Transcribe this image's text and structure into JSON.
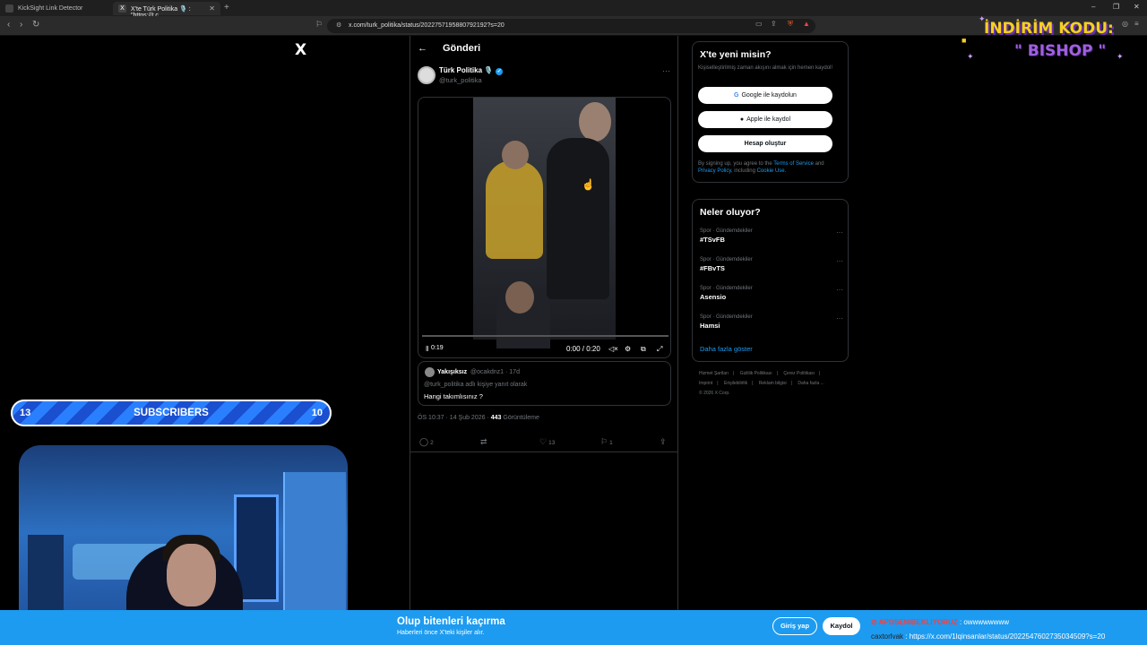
{
  "browser": {
    "tabs": [
      {
        "label": "KickSight Link Detector",
        "active": false
      },
      {
        "label": "X'te Türk Politika 🎙️ : \"https://t.c",
        "active": true
      }
    ],
    "new_tab": "+",
    "url": "x.com/turk_politika/status/2022757195880792192?s=20",
    "window_controls": [
      "–",
      "❐",
      "✕"
    ]
  },
  "x": {
    "logo": "X",
    "page_title": "Gönderi",
    "tweet": {
      "author_name": "Türk Politika 🎙️",
      "author_handle": "@turk_politika",
      "video": {
        "time": "0:00 / 0:20",
        "remaining": "0:19",
        "progress": 0
      },
      "quoted": {
        "name": "Yakışıksız",
        "meta": "@ocakdnz1 · 17d",
        "reply_to": "@turk_politika adlı kişiye yanıt olarak",
        "text": "Hangi takımlısınız ?"
      },
      "time": "ÖS 10:37 · 14 Şub 2026 · ",
      "views": "443",
      "views_label": "Görüntüleme",
      "replies": "2",
      "likes": "13",
      "bookmarks": "1"
    },
    "signup": {
      "title": "X'te yeni misin?",
      "desc": "Kişiselleştirilmiş zaman akışını almak için hemen kaydol!",
      "google": "Google ile kaydolun",
      "apple": "Apple ile kaydol",
      "create": "Hesap oluştur",
      "legal_1": "By signing up, you agree to the ",
      "terms": "Terms of Service",
      "legal_2": " and ",
      "privacy": "Privacy Policy",
      "legal_3": ", including ",
      "cookie": "Cookie Use."
    },
    "trends": {
      "title": "Neler oluyor?",
      "items": [
        {
          "category": "Spor · Gündemdekiler",
          "name": "#TSvFB"
        },
        {
          "category": "Spor · Gündemdekiler",
          "name": "#FBvTS"
        },
        {
          "category": "Spor · Gündemdekiler",
          "name": "Asensio"
        },
        {
          "category": "Spor · Gündemdekiler",
          "name": "Hamsi"
        }
      ],
      "show_more": "Daha fazla göster"
    },
    "footer": {
      "line1": [
        "Hizmet Şartları",
        "Gizlilik Politikası",
        "Çerez Politikası"
      ],
      "line2": [
        "Imprint",
        "Erişilebilirlik",
        "Reklam bilgisi",
        "Daha fazla ..."
      ],
      "line3": "© 2026 X Corp."
    },
    "banner": {
      "title": "Olup bitenleri kaçırma",
      "subtitle": "Haberleri önce X'teki kişiler alır.",
      "login": "Giriş yap",
      "signup": "Kaydol"
    }
  },
  "stream": {
    "promo_line1": "İNDİRİM KODU:",
    "promo_line2": "\" BISHOP \"",
    "subs_left": "13",
    "subs_label": "SUBSCRIBERS",
    "subs_right": "10",
    "chat": [
      {
        "user": "APOSENIBEKLIYORUZ",
        "msg": ": owwwwwwww"
      },
      {
        "user": "caxtorlvak",
        "msg": ": https://x.com/1lqinsanlar/status/2022547602735034509?s=20"
      }
    ]
  }
}
